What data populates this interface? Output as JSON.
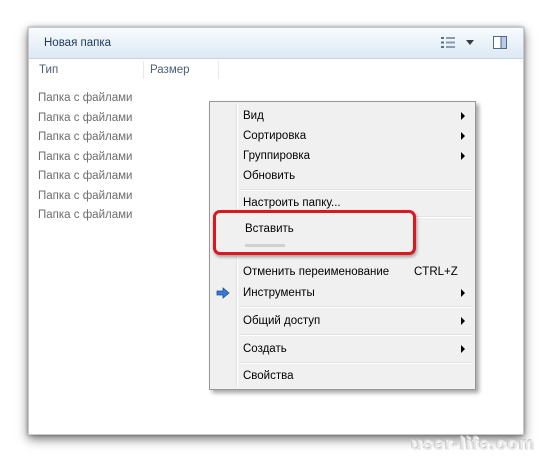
{
  "window": {
    "title": "Новая папка"
  },
  "columns": [
    "Тип",
    "Размер"
  ],
  "files": [
    "Папка с файлами",
    "Папка с файлами",
    "Папка с файлами",
    "Папка с файлами",
    "Папка с файлами",
    "Папка с файлами",
    "Папка с файлами"
  ],
  "context_menu": {
    "view": "Вид",
    "sort": "Сортировка",
    "group": "Группировка",
    "refresh": "Обновить",
    "customize": "Настроить папку...",
    "paste": "Вставить",
    "undo_rename": "Отменить переименование",
    "undo_shortcut": "CTRL+Z",
    "tools": "Инструменты",
    "share": "Общий доступ",
    "create": "Создать",
    "properties": "Свойства"
  },
  "icons": {
    "view_toggle": "view-list-icon",
    "view_dropdown": "chevron-down-icon",
    "preview_pane": "preview-pane-icon",
    "tools": "arrow-right-icon"
  },
  "colors": {
    "highlight_border": "#d9181f",
    "toolbar_text": "#1e395b",
    "header_text": "#4c607a"
  },
  "watermark": "user-life.com"
}
